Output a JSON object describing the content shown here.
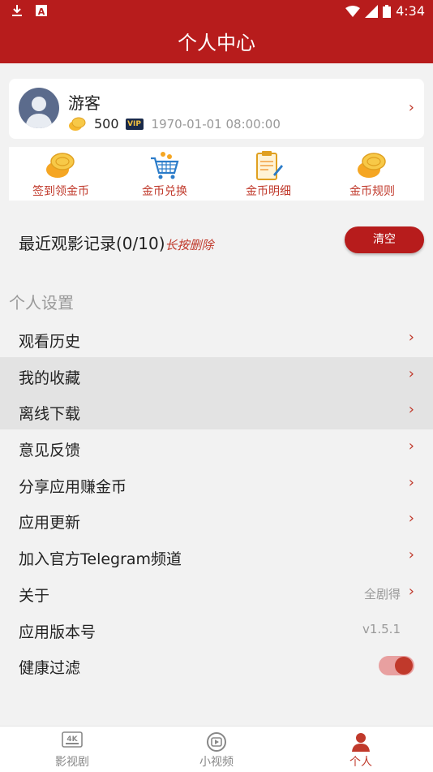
{
  "status_bar": {
    "time": "4:34"
  },
  "header": {
    "title": "个人中心"
  },
  "profile": {
    "username": "游客",
    "coins": "500",
    "vip_label": "VIP",
    "date": "1970-01-01 08:00:00"
  },
  "quick_actions": [
    {
      "label": "签到领金币",
      "icon": "coin-stack-icon"
    },
    {
      "label": "金币兑换",
      "icon": "shopping-cart-icon"
    },
    {
      "label": "金币明细",
      "icon": "clipboard-icon"
    },
    {
      "label": "金币规则",
      "icon": "coin-stack-icon"
    }
  ],
  "recent": {
    "title": "最近观影记录(0/10)",
    "hint": "长按删除",
    "clear_label": "清空"
  },
  "settings_section": {
    "title": "个人设置"
  },
  "settings": [
    {
      "label": "观看历史"
    },
    {
      "label": "我的收藏"
    },
    {
      "label": "离线下载"
    },
    {
      "label": "意见反馈"
    },
    {
      "label": "分享应用赚金币"
    },
    {
      "label": "应用更新"
    },
    {
      "label": "加入官方Telegram频道"
    },
    {
      "label": "关于",
      "value": "全剧得"
    },
    {
      "label": "应用版本号",
      "value": "v1.5.1"
    },
    {
      "label": "健康过滤",
      "toggle_on": true
    }
  ],
  "bottom_nav": [
    {
      "label": "影视剧",
      "icon": "4k-icon",
      "active": false
    },
    {
      "label": "小视频",
      "icon": "play-circle-icon",
      "active": false
    },
    {
      "label": "个人",
      "icon": "person-icon",
      "active": true
    }
  ],
  "colors": {
    "primary": "#b71c1c",
    "accent": "#c0392b",
    "bg": "#f2f2f2"
  }
}
